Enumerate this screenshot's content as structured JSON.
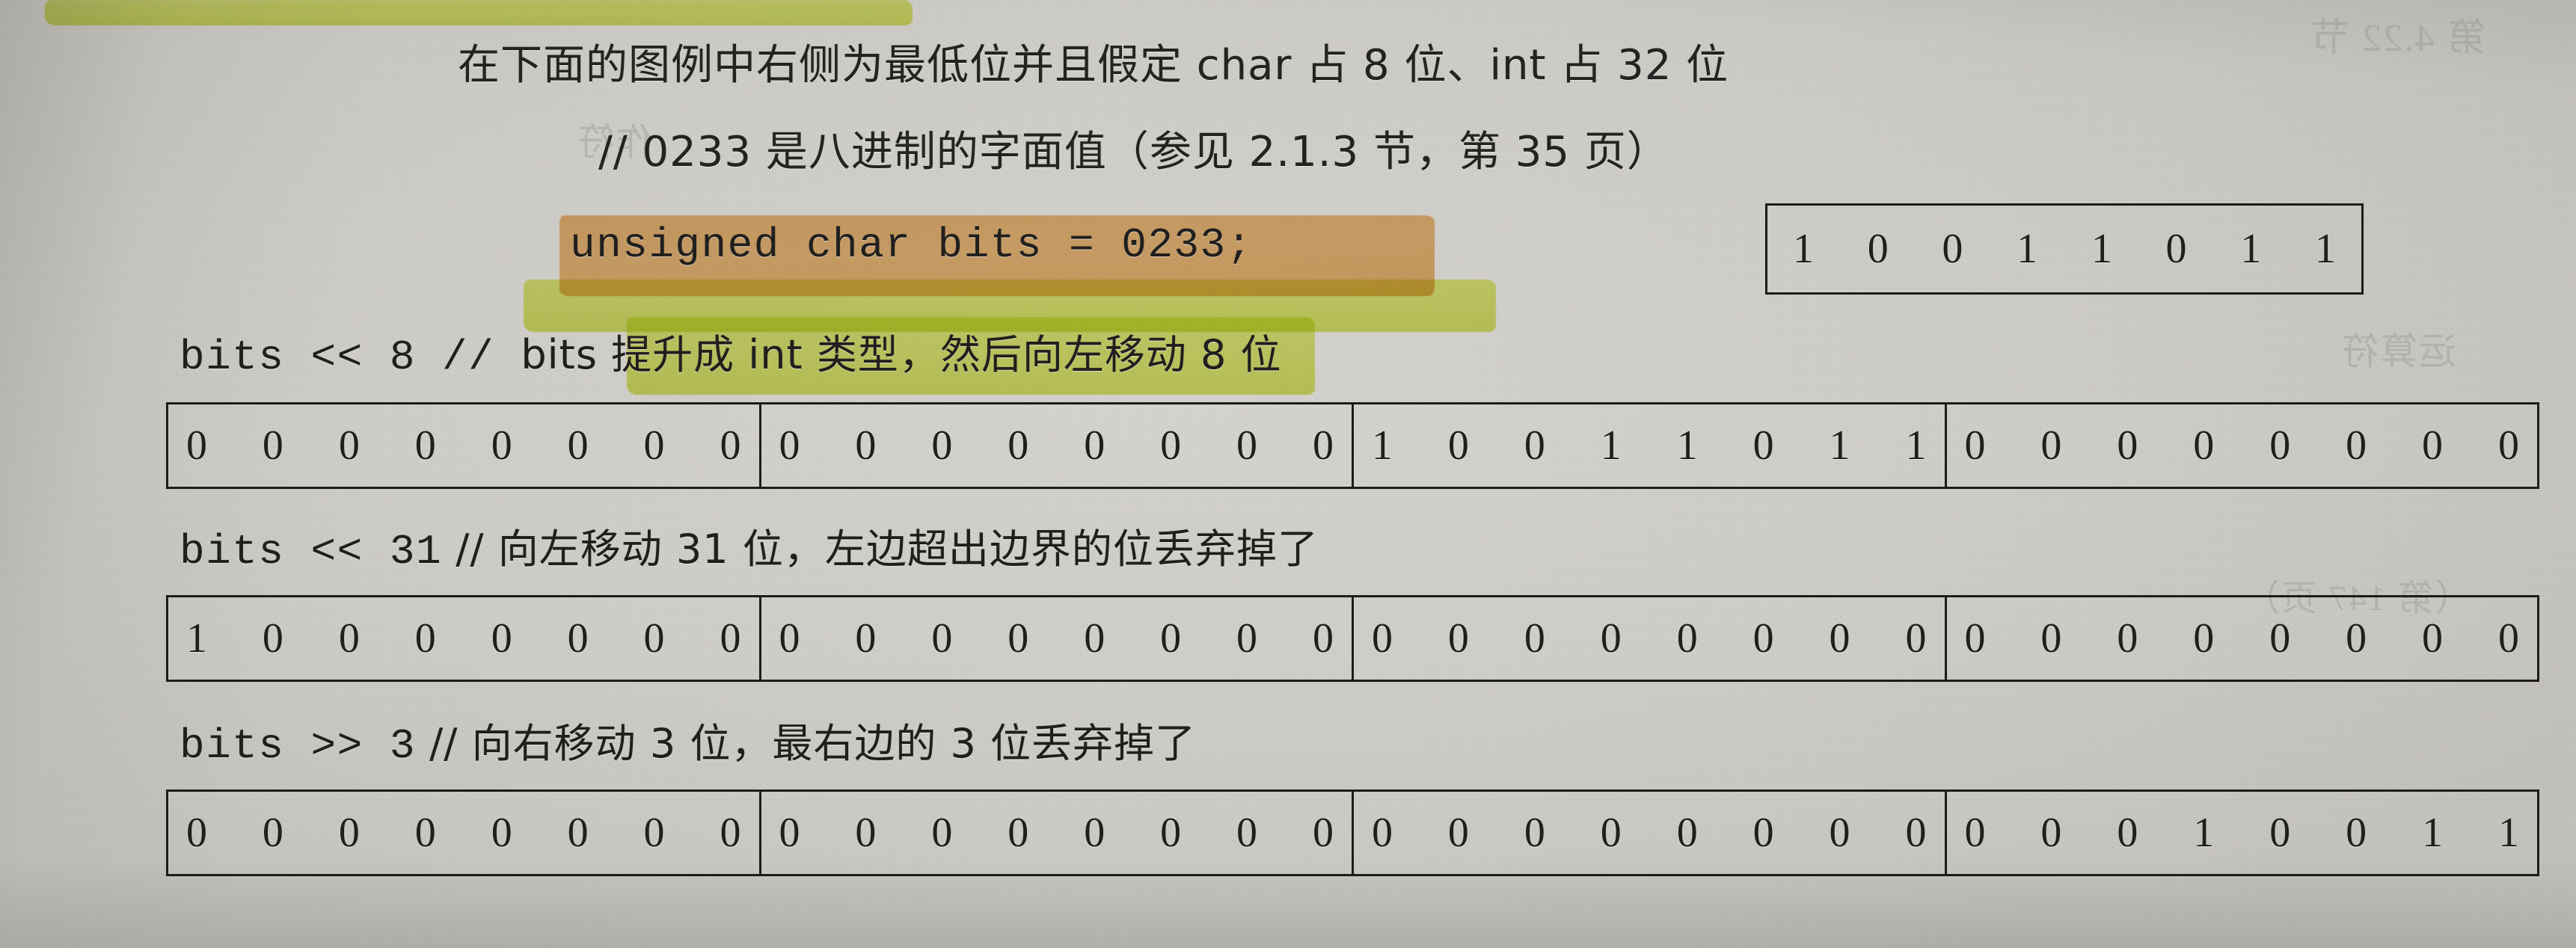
{
  "page": {
    "intro_line_1": "在下面的图例中右侧为最低位并且假定 char 占 8 位、int 占 32 位",
    "intro_line_2": "// 0233 是八进制的字面值（参见 2.1.3 节，第 35 页）"
  },
  "declaration": {
    "code": "unsigned char bits = 0233;",
    "highlight_color": "#efb971",
    "value_bits": [
      "1",
      "0",
      "0",
      "1",
      "1",
      "0",
      "1",
      "1"
    ]
  },
  "examples": [
    {
      "expression": "bits << 8",
      "comment_plain": "  //  ",
      "comment_highlighted": "bits 提升成 int 类型",
      "comment_tail": "，然后向左移动 8 位",
      "highlight_color": "#dfec6a",
      "bytes": [
        [
          "0",
          "0",
          "0",
          "0",
          "0",
          "0",
          "0",
          "0"
        ],
        [
          "0",
          "0",
          "0",
          "0",
          "0",
          "0",
          "0",
          "0"
        ],
        [
          "1",
          "0",
          "0",
          "1",
          "1",
          "0",
          "1",
          "1"
        ],
        [
          "0",
          "0",
          "0",
          "0",
          "0",
          "0",
          "0",
          "0"
        ]
      ]
    },
    {
      "expression": "bits << 31",
      "comment_plain": "  //  向左移动 31 位，左边超出边界的位丢弃掉了",
      "comment_highlighted": "",
      "comment_tail": "",
      "highlight_color": "",
      "bytes": [
        [
          "1",
          "0",
          "0",
          "0",
          "0",
          "0",
          "0",
          "0"
        ],
        [
          "0",
          "0",
          "0",
          "0",
          "0",
          "0",
          "0",
          "0"
        ],
        [
          "0",
          "0",
          "0",
          "0",
          "0",
          "0",
          "0",
          "0"
        ],
        [
          "0",
          "0",
          "0",
          "0",
          "0",
          "0",
          "0",
          "0"
        ]
      ]
    },
    {
      "expression": "bits >> 3",
      "comment_plain": "  //  向右移动 3 位，最右边的 3 位丢弃掉了",
      "comment_highlighted": "",
      "comment_tail": "",
      "highlight_color": "",
      "bytes": [
        [
          "0",
          "0",
          "0",
          "0",
          "0",
          "0",
          "0",
          "0"
        ],
        [
          "0",
          "0",
          "0",
          "0",
          "0",
          "0",
          "0",
          "0"
        ],
        [
          "0",
          "0",
          "0",
          "0",
          "0",
          "0",
          "0",
          "0"
        ],
        [
          "0",
          "0",
          "0",
          "1",
          "0",
          "0",
          "1",
          "1"
        ]
      ]
    }
  ],
  "bleed_through": {
    "top_right_1": "第 4.22 节",
    "top_right_2": "作符",
    "mid_right_1": "运算符",
    "mid_right_2": "（第 147 页）"
  }
}
